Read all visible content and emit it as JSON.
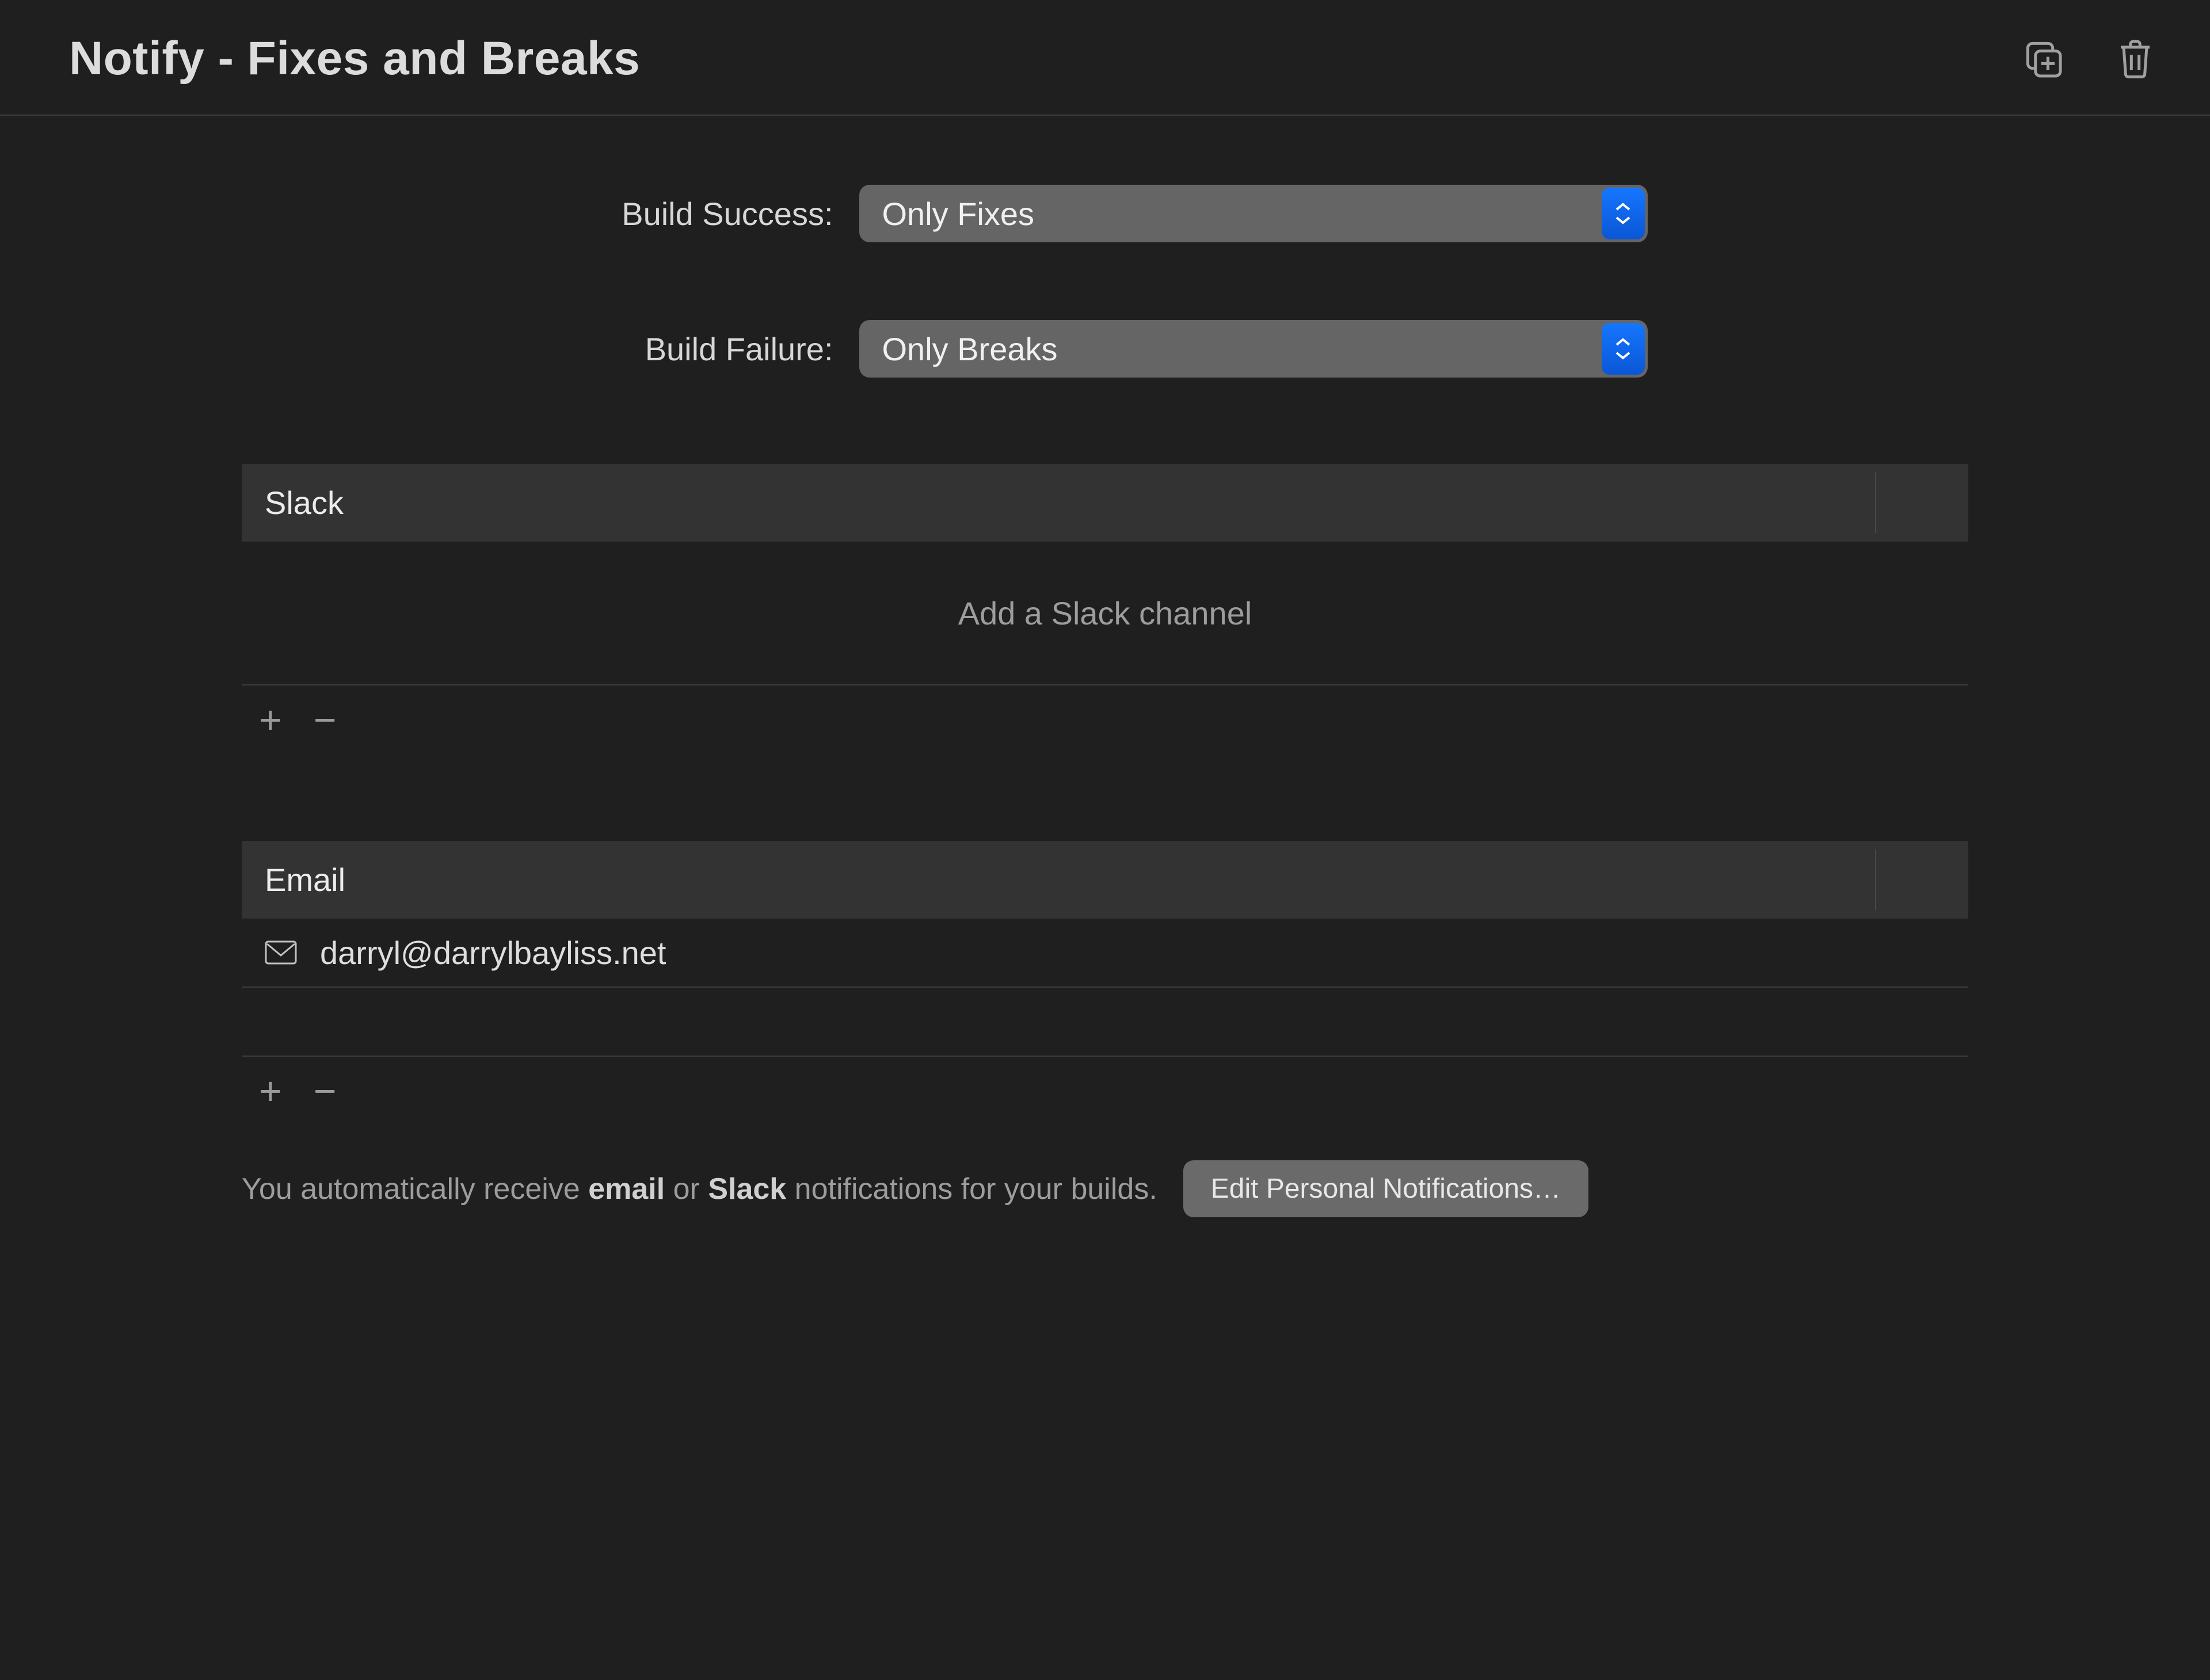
{
  "header": {
    "title": "Notify - Fixes and Breaks"
  },
  "form": {
    "build_success_label": "Build Success:",
    "build_success_value": "Only Fixes",
    "build_failure_label": "Build Failure:",
    "build_failure_value": "Only Breaks"
  },
  "slack": {
    "title": "Slack",
    "placeholder": "Add a Slack channel"
  },
  "email": {
    "title": "Email",
    "items": [
      {
        "address": "darryl@darrylbayliss.net"
      }
    ]
  },
  "footer": {
    "text_prefix": "You automatically receive ",
    "email_word": "email",
    "text_or": " or ",
    "slack_word": "Slack",
    "text_suffix": " notifications for your builds.",
    "edit_button": "Edit Personal Notifications…"
  },
  "colors": {
    "background": "#1f1f1f",
    "select_bg": "#656565",
    "select_indicator": "#0a63ff",
    "section_header_bg": "#333333",
    "button_bg": "#6a6a6a"
  }
}
